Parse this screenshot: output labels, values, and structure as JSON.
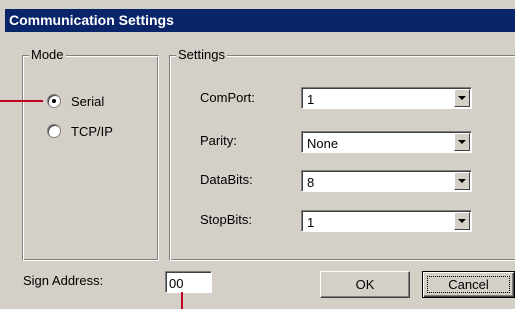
{
  "window": {
    "title": "Communication Settings"
  },
  "mode_group": {
    "label": "Mode",
    "options": [
      {
        "label": "Serial",
        "selected": true
      },
      {
        "label": "TCP/IP",
        "selected": false
      }
    ]
  },
  "settings_group": {
    "label": "Settings",
    "fields": [
      {
        "label": "ComPort:",
        "value": "1"
      },
      {
        "label": "Parity:",
        "value": "None"
      },
      {
        "label": "DataBits:",
        "value": "8"
      },
      {
        "label": "StopBits:",
        "value": "1"
      }
    ]
  },
  "sign_address": {
    "label": "Sign Address:",
    "value": "00"
  },
  "buttons": {
    "ok_label": "OK",
    "cancel_label": "Cancel"
  },
  "colors": {
    "titlebar": "#0a246a",
    "dialog_face": "#d4d0c8",
    "callout": "#c00020"
  }
}
